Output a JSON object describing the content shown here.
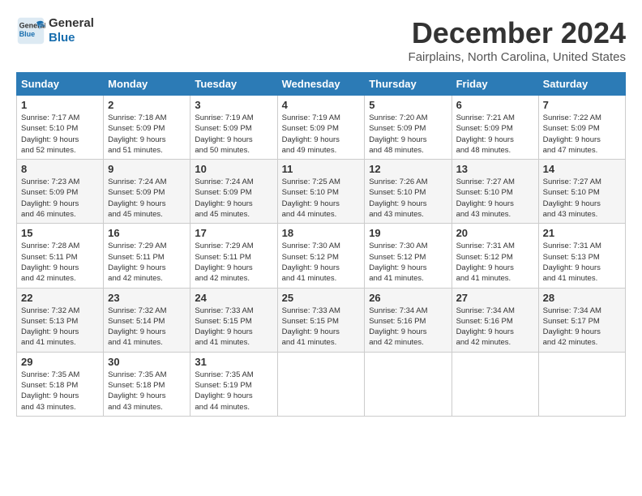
{
  "logo": {
    "line1": "General",
    "line2": "Blue"
  },
  "title": "December 2024",
  "subtitle": "Fairplains, North Carolina, United States",
  "days_of_week": [
    "Sunday",
    "Monday",
    "Tuesday",
    "Wednesday",
    "Thursday",
    "Friday",
    "Saturday"
  ],
  "weeks": [
    [
      {
        "day": "1",
        "info": "Sunrise: 7:17 AM\nSunset: 5:10 PM\nDaylight: 9 hours\nand 52 minutes."
      },
      {
        "day": "2",
        "info": "Sunrise: 7:18 AM\nSunset: 5:09 PM\nDaylight: 9 hours\nand 51 minutes."
      },
      {
        "day": "3",
        "info": "Sunrise: 7:19 AM\nSunset: 5:09 PM\nDaylight: 9 hours\nand 50 minutes."
      },
      {
        "day": "4",
        "info": "Sunrise: 7:19 AM\nSunset: 5:09 PM\nDaylight: 9 hours\nand 49 minutes."
      },
      {
        "day": "5",
        "info": "Sunrise: 7:20 AM\nSunset: 5:09 PM\nDaylight: 9 hours\nand 48 minutes."
      },
      {
        "day": "6",
        "info": "Sunrise: 7:21 AM\nSunset: 5:09 PM\nDaylight: 9 hours\nand 48 minutes."
      },
      {
        "day": "7",
        "info": "Sunrise: 7:22 AM\nSunset: 5:09 PM\nDaylight: 9 hours\nand 47 minutes."
      }
    ],
    [
      {
        "day": "8",
        "info": "Sunrise: 7:23 AM\nSunset: 5:09 PM\nDaylight: 9 hours\nand 46 minutes."
      },
      {
        "day": "9",
        "info": "Sunrise: 7:24 AM\nSunset: 5:09 PM\nDaylight: 9 hours\nand 45 minutes."
      },
      {
        "day": "10",
        "info": "Sunrise: 7:24 AM\nSunset: 5:09 PM\nDaylight: 9 hours\nand 45 minutes."
      },
      {
        "day": "11",
        "info": "Sunrise: 7:25 AM\nSunset: 5:10 PM\nDaylight: 9 hours\nand 44 minutes."
      },
      {
        "day": "12",
        "info": "Sunrise: 7:26 AM\nSunset: 5:10 PM\nDaylight: 9 hours\nand 43 minutes."
      },
      {
        "day": "13",
        "info": "Sunrise: 7:27 AM\nSunset: 5:10 PM\nDaylight: 9 hours\nand 43 minutes."
      },
      {
        "day": "14",
        "info": "Sunrise: 7:27 AM\nSunset: 5:10 PM\nDaylight: 9 hours\nand 43 minutes."
      }
    ],
    [
      {
        "day": "15",
        "info": "Sunrise: 7:28 AM\nSunset: 5:11 PM\nDaylight: 9 hours\nand 42 minutes."
      },
      {
        "day": "16",
        "info": "Sunrise: 7:29 AM\nSunset: 5:11 PM\nDaylight: 9 hours\nand 42 minutes."
      },
      {
        "day": "17",
        "info": "Sunrise: 7:29 AM\nSunset: 5:11 PM\nDaylight: 9 hours\nand 42 minutes."
      },
      {
        "day": "18",
        "info": "Sunrise: 7:30 AM\nSunset: 5:12 PM\nDaylight: 9 hours\nand 41 minutes."
      },
      {
        "day": "19",
        "info": "Sunrise: 7:30 AM\nSunset: 5:12 PM\nDaylight: 9 hours\nand 41 minutes."
      },
      {
        "day": "20",
        "info": "Sunrise: 7:31 AM\nSunset: 5:12 PM\nDaylight: 9 hours\nand 41 minutes."
      },
      {
        "day": "21",
        "info": "Sunrise: 7:31 AM\nSunset: 5:13 PM\nDaylight: 9 hours\nand 41 minutes."
      }
    ],
    [
      {
        "day": "22",
        "info": "Sunrise: 7:32 AM\nSunset: 5:13 PM\nDaylight: 9 hours\nand 41 minutes."
      },
      {
        "day": "23",
        "info": "Sunrise: 7:32 AM\nSunset: 5:14 PM\nDaylight: 9 hours\nand 41 minutes."
      },
      {
        "day": "24",
        "info": "Sunrise: 7:33 AM\nSunset: 5:15 PM\nDaylight: 9 hours\nand 41 minutes."
      },
      {
        "day": "25",
        "info": "Sunrise: 7:33 AM\nSunset: 5:15 PM\nDaylight: 9 hours\nand 41 minutes."
      },
      {
        "day": "26",
        "info": "Sunrise: 7:34 AM\nSunset: 5:16 PM\nDaylight: 9 hours\nand 42 minutes."
      },
      {
        "day": "27",
        "info": "Sunrise: 7:34 AM\nSunset: 5:16 PM\nDaylight: 9 hours\nand 42 minutes."
      },
      {
        "day": "28",
        "info": "Sunrise: 7:34 AM\nSunset: 5:17 PM\nDaylight: 9 hours\nand 42 minutes."
      }
    ],
    [
      {
        "day": "29",
        "info": "Sunrise: 7:35 AM\nSunset: 5:18 PM\nDaylight: 9 hours\nand 43 minutes."
      },
      {
        "day": "30",
        "info": "Sunrise: 7:35 AM\nSunset: 5:18 PM\nDaylight: 9 hours\nand 43 minutes."
      },
      {
        "day": "31",
        "info": "Sunrise: 7:35 AM\nSunset: 5:19 PM\nDaylight: 9 hours\nand 44 minutes."
      },
      {
        "day": "",
        "info": ""
      },
      {
        "day": "",
        "info": ""
      },
      {
        "day": "",
        "info": ""
      },
      {
        "day": "",
        "info": ""
      }
    ]
  ]
}
